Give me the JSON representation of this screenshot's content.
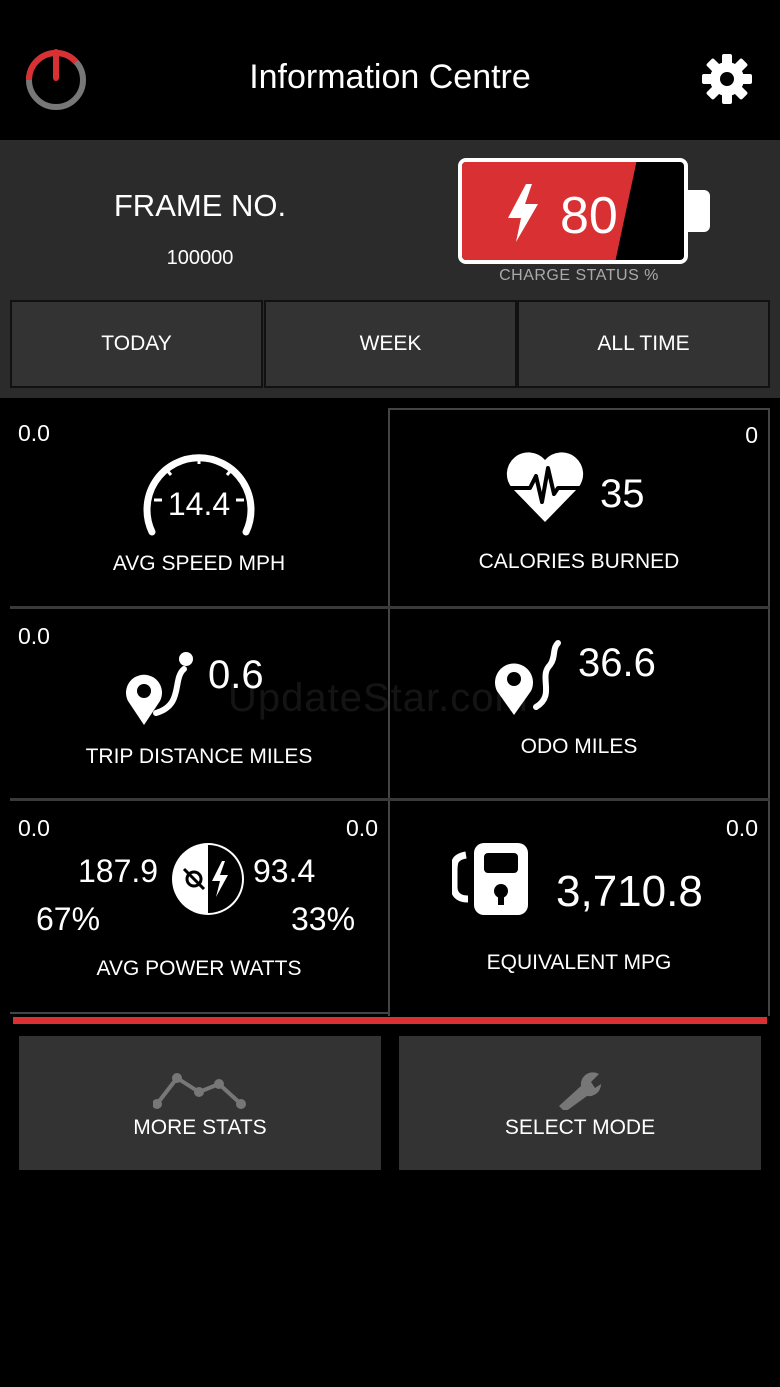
{
  "header": {
    "title": "Information Centre",
    "power_icon": "power-icon",
    "settings_icon": "gear-icon"
  },
  "frame": {
    "label": "FRAME NO.",
    "value": "100000"
  },
  "battery": {
    "charge_value": "80",
    "charge_level_percent": 80,
    "label": "CHARGE STATUS %",
    "color": "#d93033"
  },
  "tabs": [
    {
      "label": "TODAY"
    },
    {
      "label": "WEEK"
    },
    {
      "label": "ALL TIME"
    }
  ],
  "stats": {
    "avg_speed": {
      "corner": "0.0",
      "value": "14.4",
      "label": "AVG SPEED MPH",
      "icon": "speedometer-icon"
    },
    "calories": {
      "corner": "0",
      "value": "35",
      "label": "CALORIES BURNED",
      "icon": "heart-rate-icon"
    },
    "trip_distance": {
      "corner": "0.0",
      "value": "0.6",
      "label": "TRIP DISTANCE MILES",
      "icon": "route-pin-icon"
    },
    "odo": {
      "value": "36.6",
      "label": "ODO MILES",
      "icon": "odometer-pin-icon"
    },
    "avg_power": {
      "corner_left": "0.0",
      "corner_right": "0.0",
      "rider_watts": "187.9",
      "motor_watts": "93.4",
      "rider_percent": "67%",
      "motor_percent": "33%",
      "label": "AVG POWER WATTS",
      "icon": "power-split-icon"
    },
    "mpg": {
      "corner": "0.0",
      "value": "3,710.8",
      "label": "EQUIVALENT MPG",
      "icon": "fuel-pump-icon"
    }
  },
  "buttons": {
    "more_stats": {
      "label": "MORE STATS",
      "icon": "line-chart-icon"
    },
    "select_mode": {
      "label": "SELECT MODE",
      "icon": "wrench-icon"
    }
  },
  "watermark": "UpdateStar.com",
  "colors": {
    "accent": "#d93033",
    "panel": "#2b2b2b",
    "button": "#333333"
  }
}
